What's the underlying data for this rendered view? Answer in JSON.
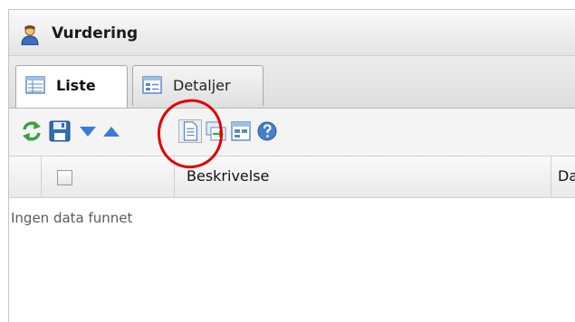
{
  "window": {
    "title": "Vurdering",
    "title_icon": "user-icon"
  },
  "tabs": [
    {
      "label": "Liste",
      "icon": "list-icon",
      "active": true
    },
    {
      "label": "Detaljer",
      "icon": "details-icon",
      "active": false
    }
  ],
  "toolbar": [
    "refresh-icon",
    "save-icon",
    "move-down-icon",
    "move-up-icon",
    "new-document-icon",
    "copy-icon",
    "export-icon",
    "help-icon"
  ],
  "grid": {
    "columns": [
      "Beskrivelse",
      "Da"
    ],
    "empty_text": "Ingen data funnet"
  },
  "colors": {
    "annotation": "#e00000",
    "accent": "#3a7bd5"
  }
}
